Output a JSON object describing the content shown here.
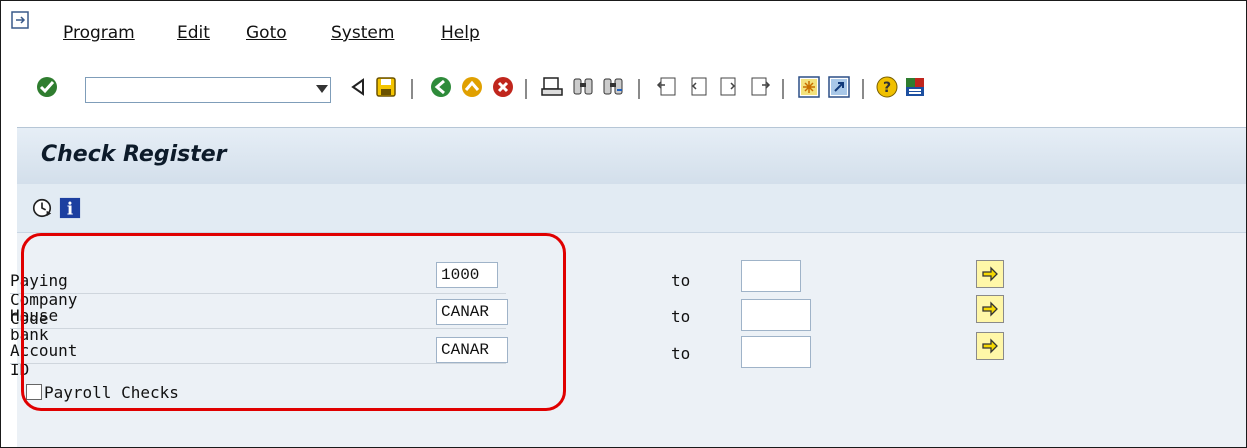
{
  "menu": {
    "items": [
      "Program",
      "Edit",
      "Goto",
      "System",
      "Help"
    ]
  },
  "toolbar": {
    "command_value": "",
    "icons": [
      "enter-icon",
      "back-nav-icon",
      "save-icon",
      "back-icon",
      "exit-icon",
      "cancel-icon",
      "print-icon",
      "find-icon",
      "find-next-icon",
      "first-page-icon",
      "previous-page-icon",
      "next-page-icon",
      "last-page-icon",
      "create-session-icon",
      "shortcut-icon",
      "help-icon",
      "customize-layout-icon"
    ]
  },
  "title": "Check Register",
  "app_toolbar": {
    "icons": [
      "execute-icon",
      "information-icon"
    ]
  },
  "selection": {
    "rows": [
      {
        "label": "Paying Company Code",
        "low": "1000",
        "to": "to",
        "high": ""
      },
      {
        "label": "House bank",
        "low": "CANAR",
        "to": "to",
        "high": ""
      },
      {
        "label": "Account ID",
        "low": "CANAR",
        "to": "to",
        "high": ""
      }
    ],
    "checkbox": {
      "label": "Payroll Checks",
      "checked": false
    }
  },
  "colors": {
    "highlight": "#e00000",
    "title_bg": "#dbe6f0",
    "multi_button": "#fff7a8"
  }
}
